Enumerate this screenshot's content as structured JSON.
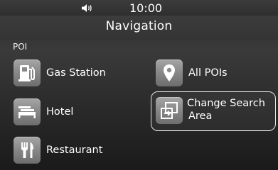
{
  "status": {
    "time": "10:00",
    "volume_icon": "speaker-volume-icon"
  },
  "header": {
    "title": "Navigation"
  },
  "section": {
    "label": "POI"
  },
  "items": [
    {
      "label": "Gas Station",
      "icon": "gas-pump-icon"
    },
    {
      "label": "Hotel",
      "icon": "bed-icon"
    },
    {
      "label": "Restaurant",
      "icon": "fork-knife-icon"
    },
    {
      "label": "All POIs",
      "icon": "map-pin-icon"
    },
    {
      "label": "Change Search Area",
      "label_line1": "Change Search",
      "label_line2": "Area",
      "icon": "change-area-icon",
      "selected": true
    }
  ],
  "colors": {
    "tile": "#8a8a8a",
    "background": "#2e2e2e",
    "text": "#ffffff"
  }
}
